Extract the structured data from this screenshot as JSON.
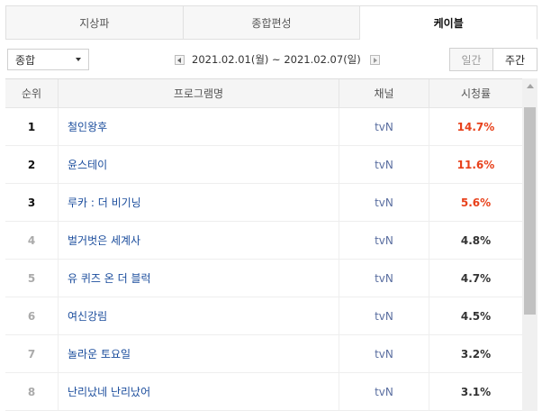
{
  "tabs": [
    {
      "label": "지상파"
    },
    {
      "label": "종합편성"
    },
    {
      "label": "케이블"
    }
  ],
  "filter": {
    "selected": "종합"
  },
  "date_range": "2021.02.01(월) ~ 2021.02.07(일)",
  "period": {
    "daily": "일간",
    "weekly": "주간"
  },
  "table": {
    "headers": {
      "rank": "순위",
      "program": "프로그램명",
      "channel": "채널",
      "rating": "시청률"
    },
    "rows": [
      {
        "rank": "1",
        "title": "철인왕후",
        "channel": "tvN",
        "rating": "14.7%"
      },
      {
        "rank": "2",
        "title": "윤스테이",
        "channel": "tvN",
        "rating": "11.6%"
      },
      {
        "rank": "3",
        "title": "루카 : 더 비기닝",
        "channel": "tvN",
        "rating": "5.6%"
      },
      {
        "rank": "4",
        "title": "벌거벗은 세계사",
        "channel": "tvN",
        "rating": "4.8%"
      },
      {
        "rank": "5",
        "title": "유 퀴즈 온 더 블럭",
        "channel": "tvN",
        "rating": "4.7%"
      },
      {
        "rank": "6",
        "title": "여신강림",
        "channel": "tvN",
        "rating": "4.5%"
      },
      {
        "rank": "7",
        "title": "놀라운 토요일",
        "channel": "tvN",
        "rating": "3.2%"
      },
      {
        "rank": "8",
        "title": "난리났네 난리났어",
        "channel": "tvN",
        "rating": "3.1%"
      }
    ]
  },
  "colors": {
    "highlight": "#e8411b",
    "link": "#1a4c9c"
  }
}
